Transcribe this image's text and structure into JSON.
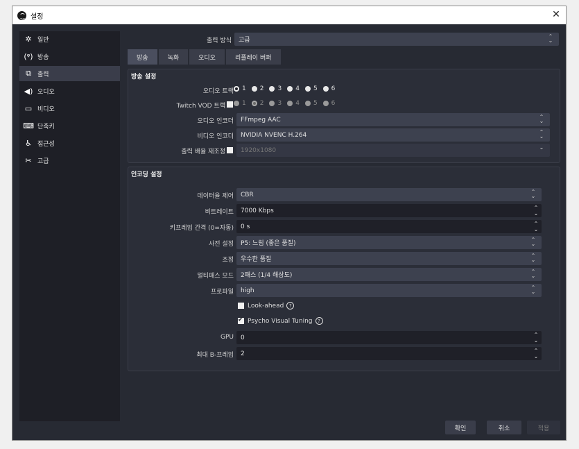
{
  "window": {
    "title": "설정",
    "close": "✕"
  },
  "sidebar": {
    "items": [
      {
        "label": "일반",
        "icon": "gear-icon",
        "glyph": "✲"
      },
      {
        "label": "방송",
        "icon": "broadcast-icon",
        "glyph": "(ᵠ)"
      },
      {
        "label": "출력",
        "icon": "output-icon",
        "glyph": "⧉"
      },
      {
        "label": "오디오",
        "icon": "speaker-icon",
        "glyph": "◀)"
      },
      {
        "label": "비디오",
        "icon": "monitor-icon",
        "glyph": "▭"
      },
      {
        "label": "단축키",
        "icon": "keyboard-icon",
        "glyph": "⌨"
      },
      {
        "label": "접근성",
        "icon": "accessibility-icon",
        "glyph": "♿"
      },
      {
        "label": "고급",
        "icon": "tools-icon",
        "glyph": "✂"
      }
    ],
    "active_index": 2
  },
  "output_mode": {
    "label": "출력 방식",
    "value": "고급"
  },
  "tabs": [
    "방송",
    "녹화",
    "오디오",
    "리플레이 버퍼"
  ],
  "stream_settings": {
    "title": "방송 설정",
    "audio_track_label": "오디오 트랙",
    "audio_tracks": [
      "1",
      "2",
      "3",
      "4",
      "5",
      "6"
    ],
    "twitch_vod_label": "Twitch VOD 트랙",
    "twitch_tracks": [
      "1",
      "2",
      "3",
      "4",
      "5",
      "6"
    ],
    "audio_encoder_label": "오디오 인코더",
    "audio_encoder": "FFmpeg AAC",
    "video_encoder_label": "비디오 인코더",
    "video_encoder": "NVIDIA NVENC H.264",
    "rescale_label": "출력 배율 재조정",
    "rescale_value": "1920x1080"
  },
  "encoder_settings": {
    "title": "인코딩 설정",
    "rate_control_label": "데이터율 제어",
    "rate_control": "CBR",
    "bitrate_label": "비트레이트",
    "bitrate": "7000 Kbps",
    "keyframe_label": "키프레임 간격 (0=자동)",
    "keyframe": "0 s",
    "preset_label": "사전 설정",
    "preset": "P5: 느림 (좋은 품질)",
    "tuning_label": "조정",
    "tuning": "우수한 품질",
    "multipass_label": "멀티패스 모드",
    "multipass": "2패스 (1/4 해상도)",
    "profile_label": "프로파일",
    "profile": "high",
    "lookahead_label": "Look-ahead",
    "psycho_label": "Psycho Visual Tuning",
    "gpu_label": "GPU",
    "gpu": "0",
    "bframes_label": "최대 B-프레임",
    "bframes": "2"
  },
  "buttons": {
    "ok": "확인",
    "cancel": "취소",
    "apply": "적용"
  }
}
